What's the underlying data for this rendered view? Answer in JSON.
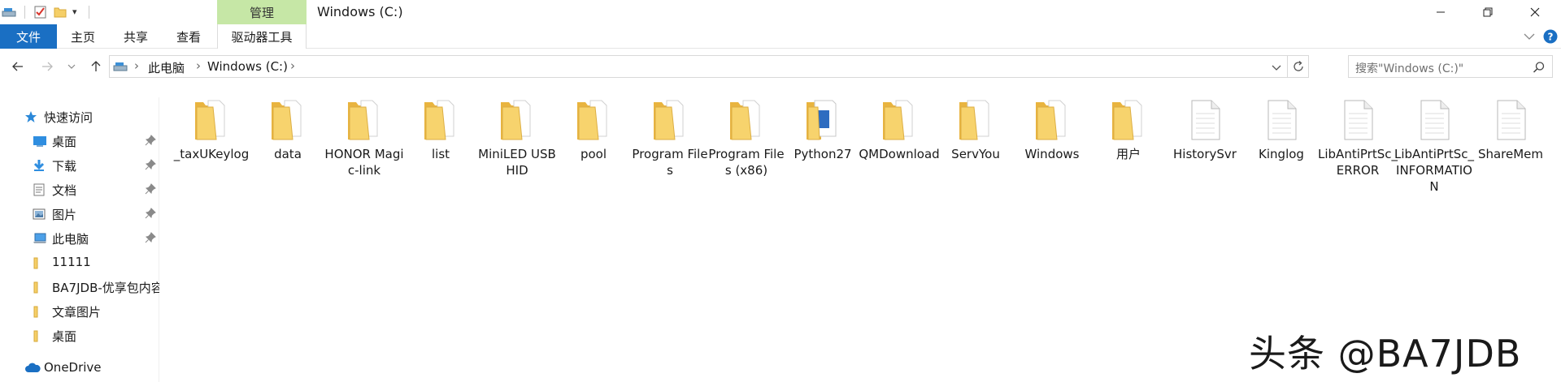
{
  "titlebar": {
    "contextual_tab": "管理",
    "window_title": "Windows (C:)"
  },
  "ribbon": {
    "tabs": [
      "文件",
      "主页",
      "共享",
      "查看",
      "驱动器工具"
    ]
  },
  "address": {
    "crumbs": [
      "此电脑",
      "Windows (C:)"
    ]
  },
  "search": {
    "placeholder": "搜索\"Windows (C:)\""
  },
  "navpane": {
    "quick_access": "快速访问",
    "items": [
      {
        "label": "桌面",
        "icon": "desktop-icon",
        "pinned": true
      },
      {
        "label": "下载",
        "icon": "download-icon",
        "pinned": true
      },
      {
        "label": "文档",
        "icon": "document-icon",
        "pinned": true
      },
      {
        "label": "图片",
        "icon": "picture-icon",
        "pinned": true
      },
      {
        "label": "此电脑",
        "icon": "computer-icon",
        "pinned": true
      },
      {
        "label": "11111",
        "icon": "folder-icon",
        "pinned": false
      },
      {
        "label": "BA7JDB-优享包内容",
        "icon": "folder-icon",
        "pinned": false
      },
      {
        "label": "文章图片",
        "icon": "folder-icon",
        "pinned": false
      },
      {
        "label": "桌面",
        "icon": "folder-icon",
        "pinned": false
      }
    ],
    "onedrive": "OneDrive"
  },
  "files": [
    {
      "name": "_taxUKeylog",
      "type": "folder"
    },
    {
      "name": "data",
      "type": "folder"
    },
    {
      "name": "HONOR Magic-link",
      "type": "folder"
    },
    {
      "name": "list",
      "type": "folder"
    },
    {
      "name": "MiniLED USB HID",
      "type": "folder"
    },
    {
      "name": "pool",
      "type": "folder"
    },
    {
      "name": "Program Files",
      "type": "folder"
    },
    {
      "name": "Program Files (x86)",
      "type": "folder"
    },
    {
      "name": "Python27",
      "type": "folder"
    },
    {
      "name": "QMDownload",
      "type": "folder"
    },
    {
      "name": "ServYou",
      "type": "folder"
    },
    {
      "name": "Windows",
      "type": "folder"
    },
    {
      "name": "用户",
      "type": "folder"
    },
    {
      "name": "HistorySvr",
      "type": "file"
    },
    {
      "name": "Kinglog",
      "type": "file"
    },
    {
      "name": "LibAntiPrtSc_ERROR",
      "type": "file"
    },
    {
      "name": "LibAntiPrtSc_INFORMATION",
      "type": "file"
    },
    {
      "name": "ShareMem",
      "type": "file"
    }
  ],
  "watermark": "头条 @BA7JDB",
  "colors": {
    "file_tab": "#1a6fc3",
    "manage_tab": "#c6e7a6",
    "folder": "#f5cf68",
    "help": "#1a6fc3"
  }
}
